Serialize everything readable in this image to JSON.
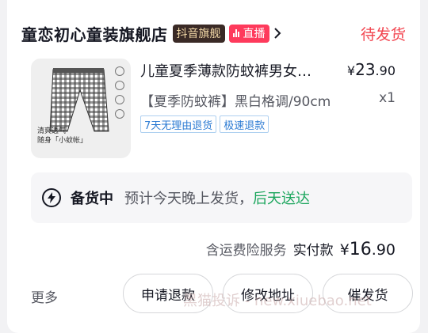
{
  "order": {
    "shop_name": "童恋初心童装旗舰店",
    "flagship_tag": "抖音旗舰",
    "live_tag": "直播",
    "status": "待发货"
  },
  "product": {
    "thumb_caption_line1": "清爽透气",
    "thumb_caption_line2": "随身「小蚊帐」",
    "title": "儿童夏季薄款防蚊裤男女…",
    "price_symbol": "¥",
    "price_int": "23",
    "price_dec": ".90",
    "spec": "【夏季防蚊裤】黑白格调/90cm",
    "quantity": "x1",
    "service_tags": [
      "7天无理由退货",
      "极速退款"
    ]
  },
  "shipping": {
    "status": "备货中",
    "desc": "预计今天晚上发货，",
    "arrival": "后天送达"
  },
  "total": {
    "insurance": "含运费险服务",
    "paid_label": "实付款",
    "symbol": "¥",
    "amount_int": "16",
    "amount_dec": ".90"
  },
  "actions": {
    "more": "更多",
    "refund": "申请退款",
    "change_address": "修改地址",
    "urge_shipping": "催发货"
  },
  "watermark": "黑猫投诉 - new.xiuebao.net",
  "colors": {
    "status_red": "#f2444f",
    "live_pink": "#fe3a5c",
    "arrival_green": "#1aa55c",
    "tag_blue": "#2c7bd3"
  }
}
